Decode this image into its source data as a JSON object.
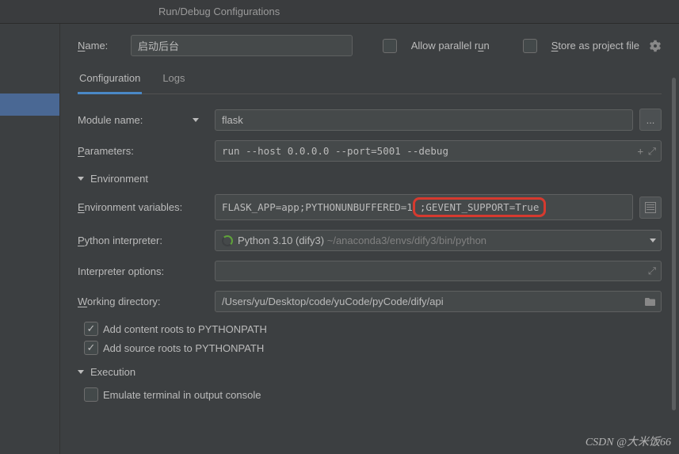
{
  "window": {
    "title": "Run/Debug Configurations"
  },
  "header": {
    "name_label": "Name:",
    "name_value": "启动后台",
    "allow_parallel": "Allow parallel run",
    "store_project": "Store as project file"
  },
  "tabs": {
    "config": "Configuration",
    "logs": "Logs"
  },
  "form": {
    "module_name_label": "Module name:",
    "module_name_value": "flask",
    "parameters_label": "Parameters:",
    "parameters_value": "run --host 0.0.0.0 --port=5001 --debug",
    "env_section": "Environment",
    "env_vars_label": "Environment variables:",
    "env_vars_value": "FLASK_APP=app;PYTHONUNBUFFERED=1",
    "env_vars_highlight": ";GEVENT_SUPPORT=True",
    "interpreter_label": "Python interpreter:",
    "interpreter_name": "Python 3.10 (dify3)",
    "interpreter_path": "~/anaconda3/envs/dify3/bin/python",
    "interpreter_opts_label": "Interpreter options:",
    "interpreter_opts_value": "",
    "working_dir_label": "Working directory:",
    "working_dir_value": "/Users/yu/Desktop/code/yuCode/pyCode/dify/api",
    "add_content_roots": "Add content roots to PYTHONPATH",
    "add_source_roots": "Add source roots to PYTHONPATH",
    "execution_section": "Execution",
    "emulate_terminal": "Emulate terminal in output console"
  },
  "watermark": "CSDN @大米饭66"
}
